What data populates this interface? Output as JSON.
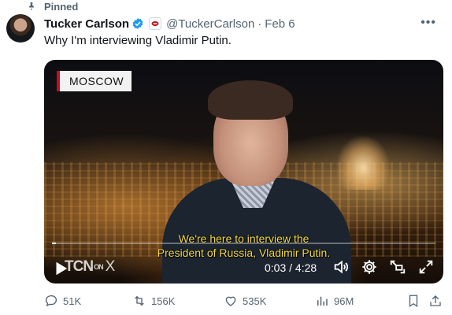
{
  "pinned": {
    "label": "Pinned"
  },
  "author": {
    "name": "Tucker Carlson",
    "handle": "@TuckerCarlson",
    "date": "Feb 6",
    "separator": "·"
  },
  "tweet": {
    "text": "Why I'm interviewing Vladimir Putin."
  },
  "video": {
    "location_label": "MOSCOW",
    "subtitle_lines": [
      "We're here to interview the",
      "President of Russia, Vladimir Putin."
    ],
    "watermark": "TCN",
    "watermark_on": "ON",
    "watermark_x": "X",
    "time_current": "0:03",
    "time_total": "4:28",
    "time_separator": "/",
    "progress_fraction": 0.011
  },
  "actions": {
    "replies": "51K",
    "reposts": "156K",
    "likes": "535K",
    "views": "96M"
  },
  "colors": {
    "verified_blue": "#1d9bf0",
    "subtitle_yellow": "#f3da3b",
    "secondary_text": "#536471",
    "brand_red": "#c20f1d"
  },
  "icons": {
    "pin": "pin-icon",
    "verified": "verified-badge-icon",
    "affiliate": "affiliate-badge-icon",
    "more": "more-icon",
    "play": "play-icon",
    "volume": "volume-icon",
    "settings": "gear-icon",
    "pip": "picture-in-picture-icon",
    "fullscreen": "fullscreen-icon",
    "reply": "reply-icon",
    "repost": "repost-icon",
    "like": "heart-icon",
    "views": "views-icon",
    "bookmark": "bookmark-icon",
    "share": "share-icon"
  }
}
